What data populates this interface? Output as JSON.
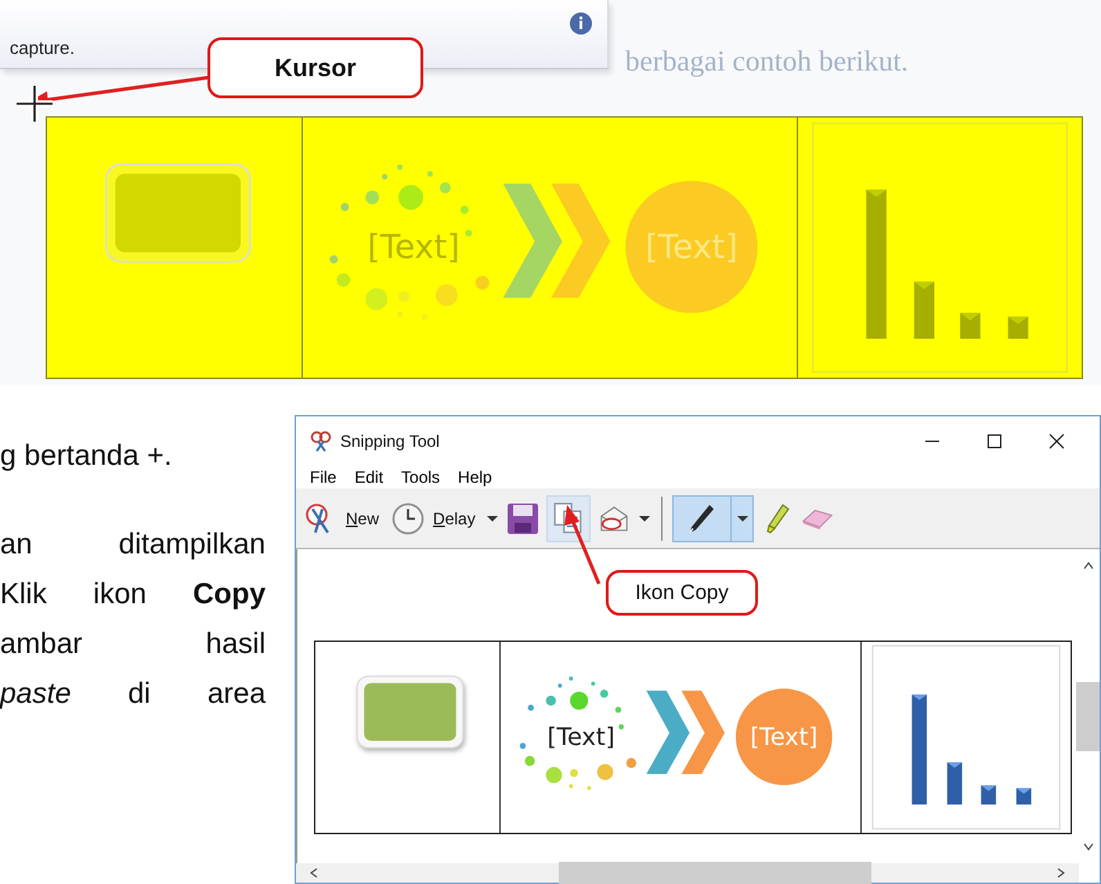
{
  "capture_screenshot": {
    "tooltip": {
      "text": "capture."
    },
    "document_text": "berbagai contoh berikut.",
    "callout": "Kursor",
    "graphic": {
      "text_left": "[Text]",
      "text_circle": "[Text]"
    }
  },
  "body_text": [
    {
      "text": "g bertanda +.",
      "paragraph_end": true
    },
    {
      "text": "an ditampilkan",
      "paragraph_end": false
    },
    {
      "text": "Klik ikon **Copy**",
      "paragraph_end": false
    },
    {
      "text": "ambar hasil",
      "paragraph_end": false
    },
    {
      "text": "*paste* di area",
      "paragraph_end": false
    }
  ],
  "snipping_tool": {
    "title": "Snipping Tool",
    "menu": [
      "File",
      "Edit",
      "Tools",
      "Help"
    ],
    "toolbar": {
      "new": {
        "label": "New"
      },
      "delay": {
        "label": "Delay"
      },
      "copy": {
        "highlighted": true
      },
      "pen": {
        "selected": true
      }
    },
    "callout": "Ikon Copy",
    "graphic": {
      "text_left": "[Text]",
      "text_circle": "[Text]"
    }
  }
}
